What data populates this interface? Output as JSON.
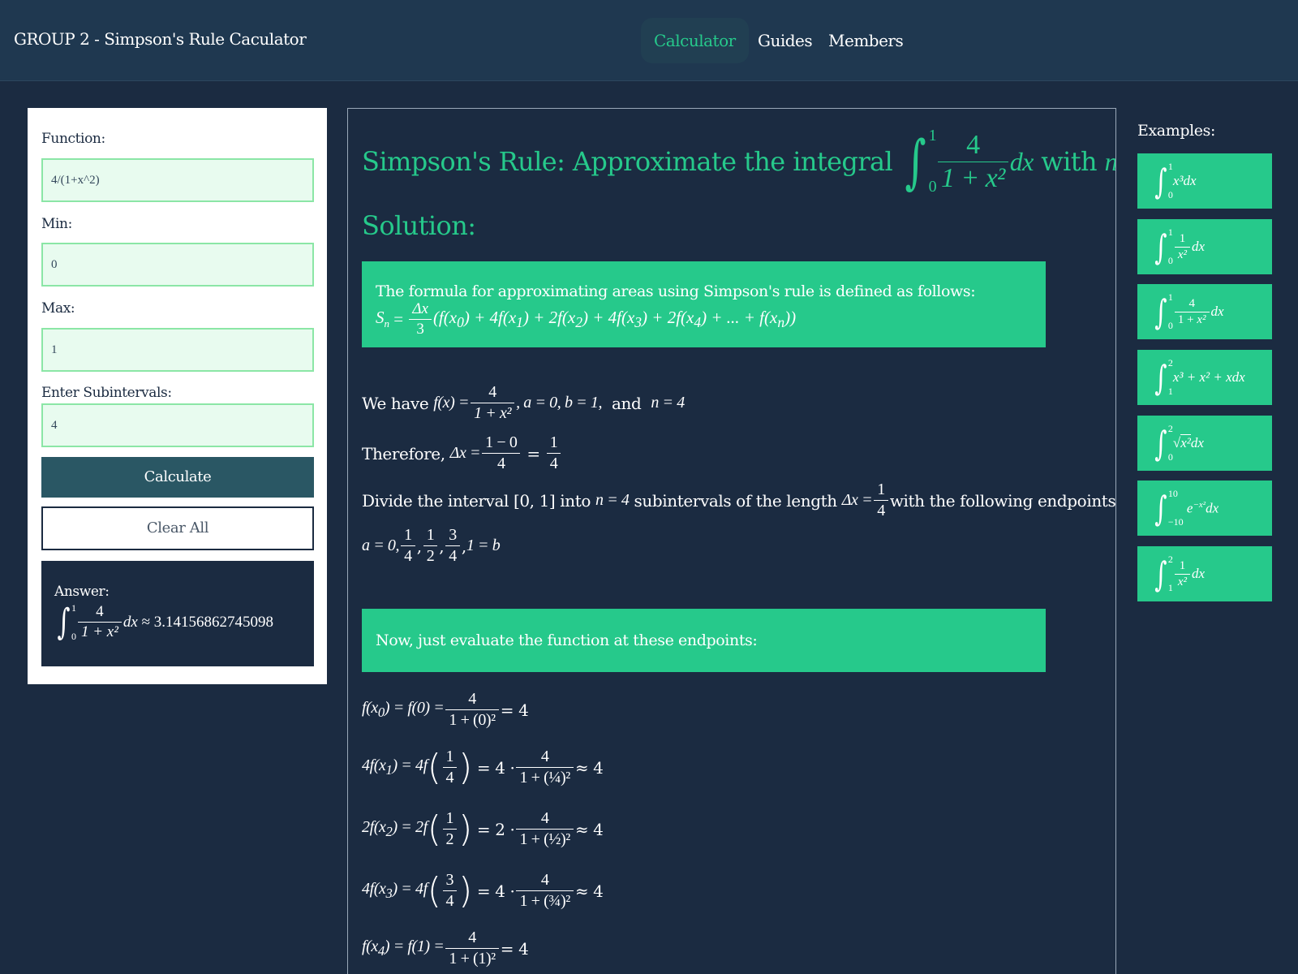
{
  "header": {
    "brand": "GROUP 2 - Simpson's Rule Caculator",
    "nav": [
      "Calculator",
      "Guides",
      "Members"
    ]
  },
  "form": {
    "function_label": "Function:",
    "function_value": "4/(1+x^2)",
    "min_label": "Min:",
    "min_value": "0",
    "max_label": "Max:",
    "max_value": "1",
    "subintervals_label": "Enter Subintervals:",
    "subintervals_value": "4",
    "calculate_label": "Calculate",
    "clear_label": "Clear All",
    "answer_label": "Answer:",
    "answer_value": "3.14156862745098"
  },
  "solution": {
    "title_prefix": "Simpson's Rule: Approximate the integral",
    "title_with": "with",
    "n": "4",
    "heading": "Solution:",
    "formula_intro": "The formula for approximating areas using Simpson's rule is defined as follows:",
    "we_have": "We have",
    "therefore": "Therefore,",
    "divide_prefix": "Divide the interval",
    "divide_into": "into",
    "divide_suffix_a": "subintervals of the length",
    "divide_suffix_b": "with the following endpoints:",
    "evaluate": "Now, just evaluate the function at these endpoints:"
  },
  "examples": {
    "title": "Examples:"
  },
  "colors": {
    "background": "#1b2b41",
    "header": "#1f3850",
    "accent": "#26c98b",
    "button": "#2a5764"
  }
}
